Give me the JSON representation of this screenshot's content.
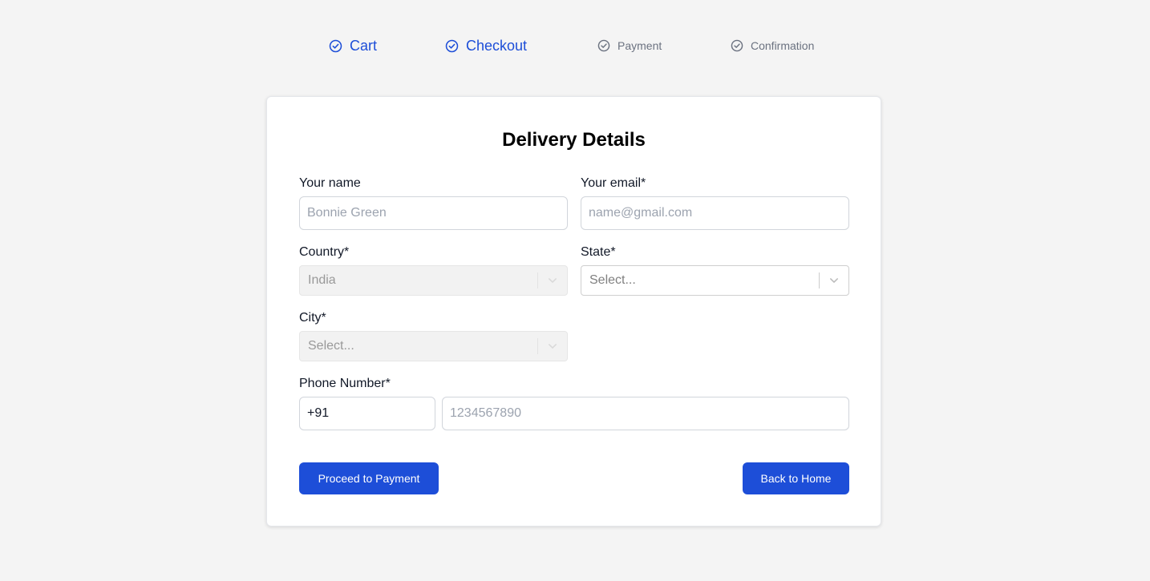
{
  "stepper": {
    "steps": [
      {
        "label": "Cart",
        "state": "completed"
      },
      {
        "label": "Checkout",
        "state": "current"
      },
      {
        "label": "Payment",
        "state": "pending"
      },
      {
        "label": "Confirmation",
        "state": "pending"
      }
    ],
    "active_color": "#1d4ed8",
    "inactive_color": "#6b7280",
    "icon": "check-circle-icon"
  },
  "form": {
    "title": "Delivery Details",
    "name": {
      "label": "Your name",
      "placeholder": "Bonnie Green",
      "value": ""
    },
    "email": {
      "label": "Your email*",
      "placeholder": "name@gmail.com",
      "value": ""
    },
    "country": {
      "label": "Country*",
      "value": "India",
      "disabled": true
    },
    "state": {
      "label": "State*",
      "value": "Select...",
      "disabled": false
    },
    "city": {
      "label": "City*",
      "value": "Select...",
      "disabled": true
    },
    "phone": {
      "label": "Phone Number*",
      "code": "+91",
      "placeholder": "1234567890",
      "value": ""
    },
    "proceed_label": "Proceed to Payment",
    "back_label": "Back to Home"
  },
  "colors": {
    "primary": "#1d4ed8",
    "background": "#f4f4f4",
    "card": "#ffffff"
  }
}
